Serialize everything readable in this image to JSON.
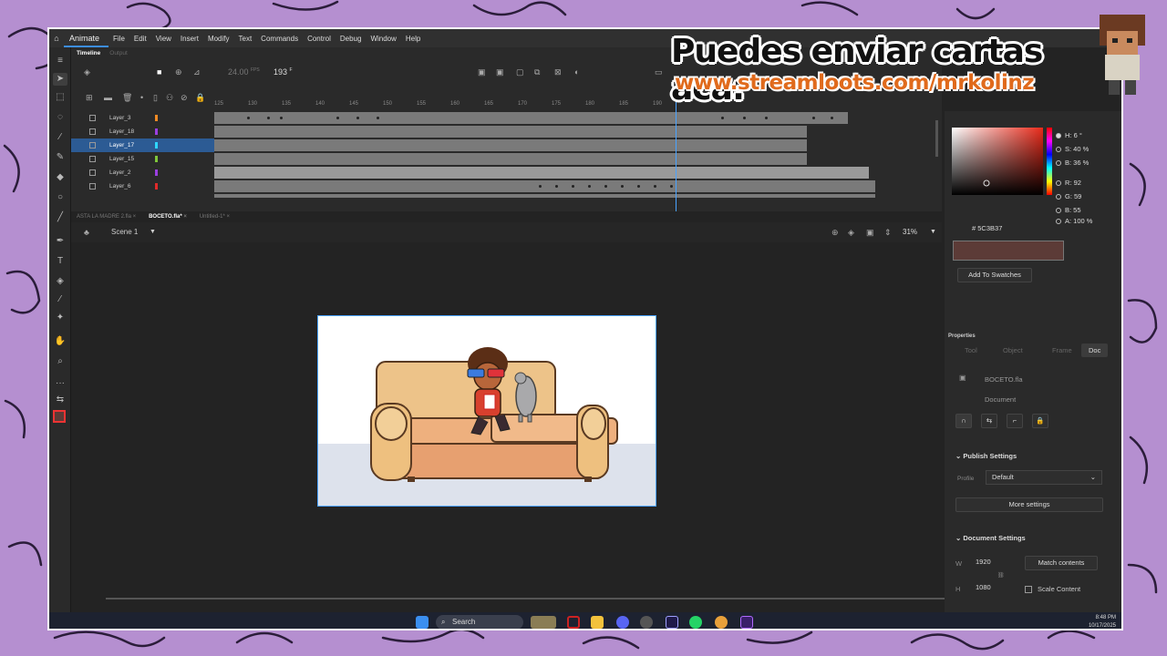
{
  "banner": {
    "line1": "Puedes enviar cartas aca:",
    "line2": "www.streamloots.com/mrkolinz"
  },
  "menubar": {
    "app": "Animate",
    "items": [
      "File",
      "Edit",
      "View",
      "Insert",
      "Modify",
      "Text",
      "Commands",
      "Control",
      "Debug",
      "Window",
      "Help"
    ]
  },
  "timeline": {
    "tabs": [
      "Timeline",
      "Output"
    ],
    "fps": "24.00",
    "fps_unit": "FPS",
    "frame": "193",
    "frame_unit": "F",
    "ruler": [
      "125",
      "130",
      "135",
      "140",
      "145",
      "150",
      "155",
      "160",
      "165",
      "170",
      "175",
      "180",
      "185",
      "190"
    ],
    "layers": [
      {
        "name": "Layer_3",
        "color": "#f08a24"
      },
      {
        "name": "Layer_18",
        "color": "#9b3fe0"
      },
      {
        "name": "Layer_17",
        "color": "#2fd6ff"
      },
      {
        "name": "Layer_15",
        "color": "#7fc63a"
      },
      {
        "name": "Layer_2",
        "color": "#9b3fe0"
      },
      {
        "name": "Layer_6",
        "color": "#e02a2a"
      }
    ]
  },
  "doc_tabs": [
    "ASTA LA MADRE 2.fla",
    "BOCETO.fla*",
    "Untitled-1*"
  ],
  "scene": {
    "label": "Scene 1",
    "zoom": "31%"
  },
  "color_panel": {
    "H": "H: 6 °",
    "S": "S: 40 %",
    "B": "B: 36 %",
    "R": "R: 92",
    "G": "G: 59",
    "Bv": "B: 55",
    "A": "A: 100 %",
    "hex": "5C3B37",
    "hex_prefix": "#",
    "swatch_color": "#5c3b37",
    "add_swatches": "Add To Swatches"
  },
  "properties": {
    "title": "Properties",
    "tabs": [
      "Tool",
      "Object",
      "Frame",
      "Doc"
    ],
    "file": "BOCETO.fla",
    "type": "Document",
    "publish_settings": "Publish Settings",
    "profile_label": "Profile",
    "profile_value": "Default",
    "more_settings": "More settings",
    "document_settings": "Document Settings",
    "w_label": "W",
    "w_value": "1920",
    "h_label": "H",
    "h_value": "1080",
    "match_contents": "Match contents",
    "scale_content": "Scale Content"
  },
  "taskbar": {
    "search": "Search",
    "time": "8:48 PM",
    "date": "10/17/2025"
  }
}
